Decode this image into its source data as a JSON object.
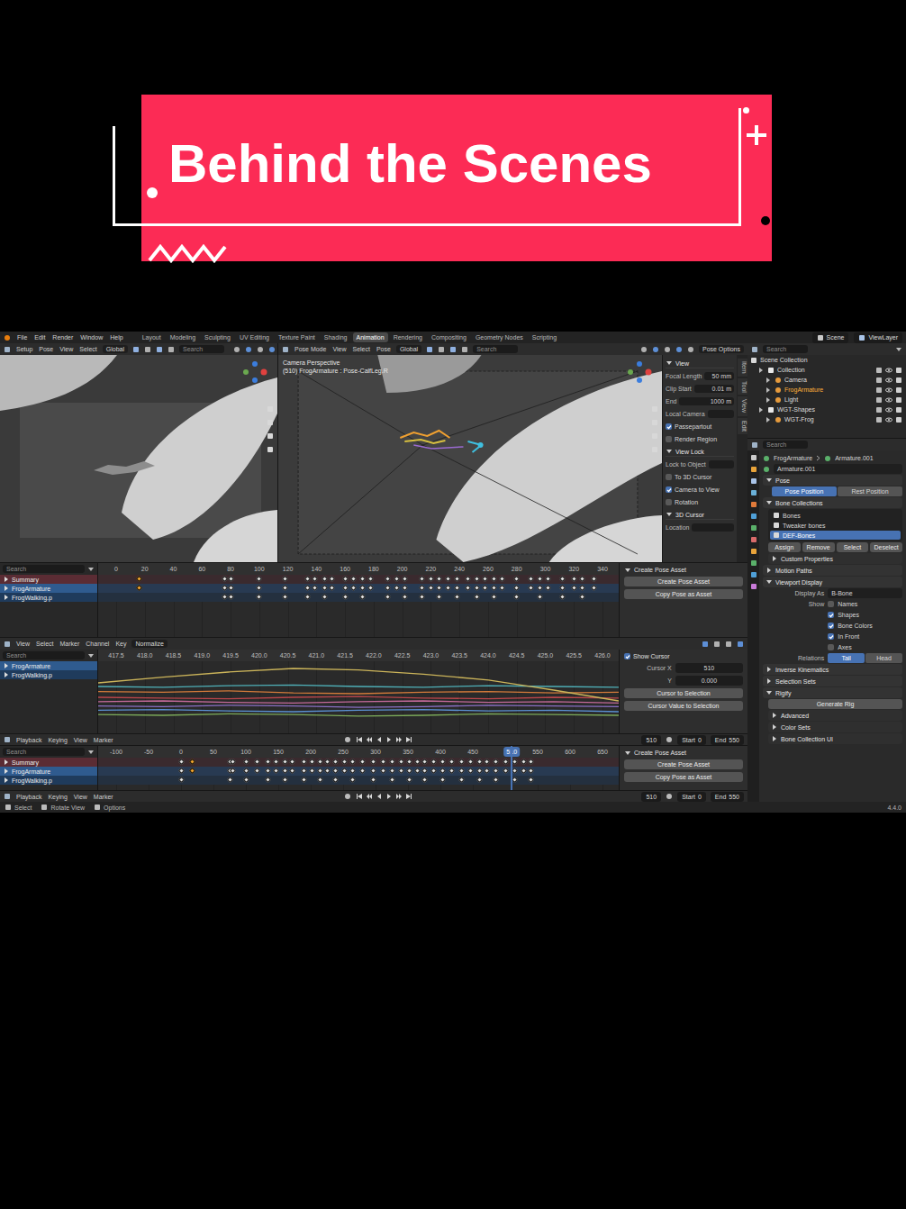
{
  "overlay": {
    "title": "Behind the Scenes"
  },
  "topbar": {
    "menu": [
      "File",
      "Edit",
      "Render",
      "Window",
      "Help"
    ],
    "workspaces": [
      {
        "label": "Layout",
        "selected": false
      },
      {
        "label": "Modeling",
        "selected": false
      },
      {
        "label": "Sculpting",
        "selected": false
      },
      {
        "label": "UV Editing",
        "selected": false
      },
      {
        "label": "Texture Paint",
        "selected": false
      },
      {
        "label": "Shading",
        "selected": false
      },
      {
        "label": "Animation",
        "selected": true
      },
      {
        "label": "Rendering",
        "selected": false
      },
      {
        "label": "Compositing",
        "selected": false
      },
      {
        "label": "Geometry Nodes",
        "selected": false
      },
      {
        "label": "Scripting",
        "selected": false
      }
    ],
    "scene": "Scene",
    "view_layer": "ViewLayer"
  },
  "viewports": [
    {
      "menu": [
        "Setup",
        "Pose",
        "View",
        "Select"
      ],
      "orientation": "Global",
      "search": "Search",
      "overlay_text": []
    },
    {
      "menu": [
        "Pose Mode",
        "View",
        "Select",
        "Pose"
      ],
      "orientation": "Global",
      "search": "Search",
      "overlay_text": [
        "Camera Perspective",
        "(510) FrogArmature : Pose-CalfLeg.R"
      ],
      "options": "Pose Options"
    }
  ],
  "npanel": {
    "tabs": [
      "Item",
      "Tool",
      "View",
      "Edit"
    ],
    "rows": [
      {
        "kind": "section",
        "label": "View"
      },
      {
        "kind": "field",
        "label": "Focal Length",
        "value": "50 mm"
      },
      {
        "kind": "field",
        "label": "Clip Start",
        "value": "0.01 m"
      },
      {
        "kind": "field",
        "label": "End",
        "value": "1000 m"
      },
      {
        "kind": "field",
        "label": "Local Camera",
        "value": ""
      },
      {
        "kind": "check",
        "label": "Passepartout",
        "checked": true
      },
      {
        "kind": "check",
        "label": "Render Region",
        "checked": false
      },
      {
        "kind": "section",
        "label": "View Lock"
      },
      {
        "kind": "field",
        "label": "Lock to Object",
        "value": ""
      },
      {
        "kind": "check",
        "label": "To 3D Cursor",
        "checked": false
      },
      {
        "kind": "check",
        "label": "Camera to View",
        "checked": true
      },
      {
        "kind": "check",
        "label": "Rotation",
        "checked": false
      },
      {
        "kind": "section",
        "label": "3D Cursor"
      },
      {
        "kind": "field",
        "label": "Location",
        "value": ""
      }
    ]
  },
  "dopesheet_top": {
    "search": "Search",
    "ticks": [
      "0",
      "20",
      "40",
      "60",
      "80",
      "100",
      "120",
      "140",
      "160",
      "180",
      "200",
      "220",
      "240",
      "260",
      "280",
      "300",
      "320",
      "340"
    ],
    "channels": [
      {
        "label": "Summary",
        "kind": "summary",
        "keys": [
          76,
          80,
          100,
          118,
          134,
          139,
          146,
          151,
          160,
          166,
          172,
          178,
          190,
          196,
          202,
          214,
          220,
          226,
          232,
          238,
          246,
          252,
          258,
          264,
          270,
          280,
          290,
          296,
          302,
          312,
          320,
          326,
          334
        ],
        "selected_keys": [
          16
        ]
      },
      {
        "label": "FrogArmature",
        "kind": "object",
        "keys": [
          76,
          80,
          100,
          118,
          134,
          139,
          146,
          151,
          160,
          166,
          172,
          178,
          190,
          196,
          202,
          214,
          220,
          226,
          232,
          238,
          246,
          252,
          258,
          264,
          270,
          280,
          290,
          296,
          302,
          312,
          320,
          326,
          334
        ],
        "selected_keys": [
          16
        ]
      },
      {
        "label": "FrogWalking.p",
        "kind": "action",
        "keys": [
          76,
          80,
          100,
          118,
          134,
          146,
          160,
          172,
          190,
          202,
          214,
          226,
          238,
          252,
          264,
          280,
          296,
          312,
          326
        ],
        "selected_keys": []
      }
    ],
    "sidebar": {
      "title": "Create Pose Asset",
      "buttons": [
        "Create Pose Asset",
        "Copy Pose as Asset"
      ]
    }
  },
  "graph": {
    "menu": [
      "View",
      "Select",
      "Marker",
      "Channel",
      "Key"
    ],
    "normalize": "Normalize",
    "search": "Search",
    "ticks": [
      "417.5",
      "418.0",
      "418.5",
      "419.0",
      "419.5",
      "420.0",
      "420.5",
      "421.0",
      "421.5",
      "422.0",
      "422.5",
      "423.0",
      "423.5",
      "424.0",
      "424.5",
      "425.0",
      "425.5",
      "426.0"
    ],
    "channels": [
      {
        "label": "FrogArmature",
        "kind": "object"
      },
      {
        "label": "FrogWalking.p",
        "kind": "action"
      }
    ],
    "curves": [
      {
        "color": "#d27a3a",
        "values": [
          0.42,
          0.43,
          0.41,
          0.44,
          0.45,
          0.43,
          0.42,
          0.44,
          0.43
        ]
      },
      {
        "color": "#b8454a",
        "values": [
          0.5,
          0.51,
          0.52,
          0.5,
          0.49,
          0.51,
          0.52,
          0.5,
          0.51
        ]
      },
      {
        "color": "#c46a9a",
        "values": [
          0.56,
          0.55,
          0.57,
          0.58,
          0.56,
          0.55,
          0.57,
          0.56,
          0.58
        ]
      },
      {
        "color": "#8a6fc4",
        "values": [
          0.62,
          0.63,
          0.61,
          0.62,
          0.64,
          0.63,
          0.61,
          0.62,
          0.63
        ]
      },
      {
        "color": "#5a8fd0",
        "values": [
          0.68,
          0.67,
          0.69,
          0.7,
          0.68,
          0.67,
          0.69,
          0.68,
          0.7
        ]
      },
      {
        "color": "#4fb0b8",
        "values": [
          0.35,
          0.36,
          0.34,
          0.33,
          0.35,
          0.36,
          0.34,
          0.35,
          0.36
        ]
      },
      {
        "color": "#7cab5a",
        "values": [
          0.74,
          0.75,
          0.73,
          0.74,
          0.76,
          0.75,
          0.73,
          0.74,
          0.75
        ]
      },
      {
        "color": "#cbb45a",
        "values": [
          0.3,
          0.22,
          0.15,
          0.1,
          0.12,
          0.18,
          0.26,
          0.4,
          0.55
        ]
      }
    ],
    "sidebar": {
      "show_cursor": {
        "label": "Show Cursor",
        "checked": true
      },
      "fields": [
        {
          "label": "Cursor X",
          "value": "510"
        },
        {
          "label": "Y",
          "value": "0.000"
        }
      ],
      "buttons": [
        "Cursor to Selection",
        "Cursor Value to Selection"
      ]
    }
  },
  "timelines": [
    {
      "menu": [
        "Playback",
        "Keying",
        "View",
        "Marker"
      ],
      "frame": "510",
      "start_label": "Start",
      "start": "0",
      "end_label": "End",
      "end": "550"
    },
    {
      "menu": [
        "Playback",
        "Keying",
        "View",
        "Marker"
      ],
      "frame": "510",
      "start_label": "Start",
      "start": "0",
      "end_label": "End",
      "end": "550"
    }
  ],
  "dopesheet_bottom": {
    "search": "Search",
    "current_frame": "510",
    "ticks": [
      "-100",
      "-50",
      "0",
      "50",
      "100",
      "150",
      "200",
      "250",
      "300",
      "350",
      "400",
      "450",
      "550",
      "600",
      "650"
    ],
    "channels": [
      {
        "label": "Summary",
        "kind": "summary",
        "keys": [
          0,
          76,
          80,
          100,
          118,
          134,
          146,
          160,
          172,
          190,
          202,
          214,
          226,
          238,
          252,
          264,
          280,
          296,
          312,
          326,
          340,
          352,
          364,
          376,
          390,
          404,
          418,
          432,
          446,
          460,
          472,
          486,
          500,
          514,
          528,
          540
        ],
        "selected_keys": [
          18
        ]
      },
      {
        "label": "FrogArmature",
        "kind": "object",
        "keys": [
          0,
          76,
          80,
          100,
          118,
          134,
          146,
          160,
          172,
          190,
          202,
          214,
          226,
          238,
          252,
          264,
          280,
          296,
          312,
          326,
          340,
          352,
          364,
          376,
          390,
          404,
          418,
          432,
          446,
          460,
          472,
          486,
          500,
          514,
          528,
          540
        ],
        "selected_keys": [
          18
        ]
      },
      {
        "label": "FrogWalking.p",
        "kind": "action",
        "keys": [
          0,
          76,
          100,
          134,
          160,
          190,
          214,
          238,
          264,
          296,
          326,
          352,
          376,
          404,
          432,
          460,
          486,
          514,
          540
        ],
        "selected_keys": []
      }
    ],
    "sidebar": {
      "title": "Create Pose Asset",
      "buttons": [
        "Create Pose Asset",
        "Copy Pose as Asset"
      ]
    }
  },
  "status": {
    "items": [
      "Select",
      "Rotate View",
      "Options"
    ],
    "version": "4.4.0"
  },
  "outliner": {
    "search": "Search",
    "rows": [
      {
        "label": "Scene Collection",
        "depth": 0,
        "kind": "scene",
        "active": false
      },
      {
        "label": "Collection",
        "depth": 1,
        "kind": "collection",
        "active": false
      },
      {
        "label": "Camera",
        "depth": 2,
        "kind": "camera",
        "active": false
      },
      {
        "label": "FrogArmature",
        "depth": 2,
        "kind": "armature",
        "active": true
      },
      {
        "label": "Light",
        "depth": 2,
        "kind": "light",
        "active": false
      },
      {
        "label": "WGT-Shapes",
        "depth": 1,
        "kind": "collection",
        "active": false
      },
      {
        "label": "WGT-Frog",
        "depth": 2,
        "kind": "mesh",
        "active": false
      }
    ]
  },
  "properties": {
    "search": "Search",
    "breadcrumb": [
      "FrogArmature",
      "Armature.001"
    ],
    "name": "Armature.001",
    "items": [
      {
        "kind": "panel",
        "label": "Pose",
        "expanded": true
      },
      {
        "kind": "toggle2",
        "label": "",
        "options": [
          {
            "label": "Pose Position",
            "selected": true
          },
          {
            "label": "Rest Position",
            "selected": false
          }
        ]
      },
      {
        "kind": "panel",
        "label": "Bone Collections",
        "expanded": true
      },
      {
        "kind": "list",
        "rows": [
          {
            "label": "Bones",
            "selected": false
          },
          {
            "label": "Tweaker bones",
            "selected": false
          },
          {
            "label": "DEF-Bones",
            "selected": true
          }
        ]
      },
      {
        "kind": "buttons",
        "labels": [
          "Assign",
          "Remove",
          "Select",
          "Deselect"
        ]
      },
      {
        "kind": "subpanel",
        "label": "Custom Properties",
        "expanded": false
      },
      {
        "kind": "panel",
        "label": "Motion Paths",
        "expanded": false
      },
      {
        "kind": "panel",
        "label": "Viewport Display",
        "expanded": true
      },
      {
        "kind": "field",
        "label": "Display As",
        "value": "B-Bone"
      },
      {
        "kind": "check",
        "prefix": "Show",
        "label": "Names",
        "checked": false
      },
      {
        "kind": "check",
        "prefix": "",
        "label": "Shapes",
        "checked": true
      },
      {
        "kind": "check",
        "prefix": "",
        "label": "Bone Colors",
        "checked": true
      },
      {
        "kind": "check",
        "prefix": "",
        "label": "In Front",
        "checked": true
      },
      {
        "kind": "check",
        "prefix": "",
        "label": "Axes",
        "checked": false
      },
      {
        "kind": "toggle2",
        "label": "Relations",
        "options": [
          {
            "label": "Tail",
            "selected": true
          },
          {
            "label": "Head",
            "selected": false
          }
        ]
      },
      {
        "kind": "panel",
        "label": "Inverse Kinematics",
        "expanded": false
      },
      {
        "kind": "panel",
        "label": "Selection Sets",
        "expanded": false
      },
      {
        "kind": "panel",
        "label": "Rigify",
        "expanded": true
      },
      {
        "kind": "button",
        "label": "Generate Rig"
      },
      {
        "kind": "subpanel",
        "label": "Advanced",
        "expanded": false
      },
      {
        "kind": "subpanel",
        "label": "Color Sets",
        "expanded": false
      },
      {
        "kind": "subpanel",
        "label": "Bone Collection UI",
        "expanded": false
      }
    ]
  }
}
